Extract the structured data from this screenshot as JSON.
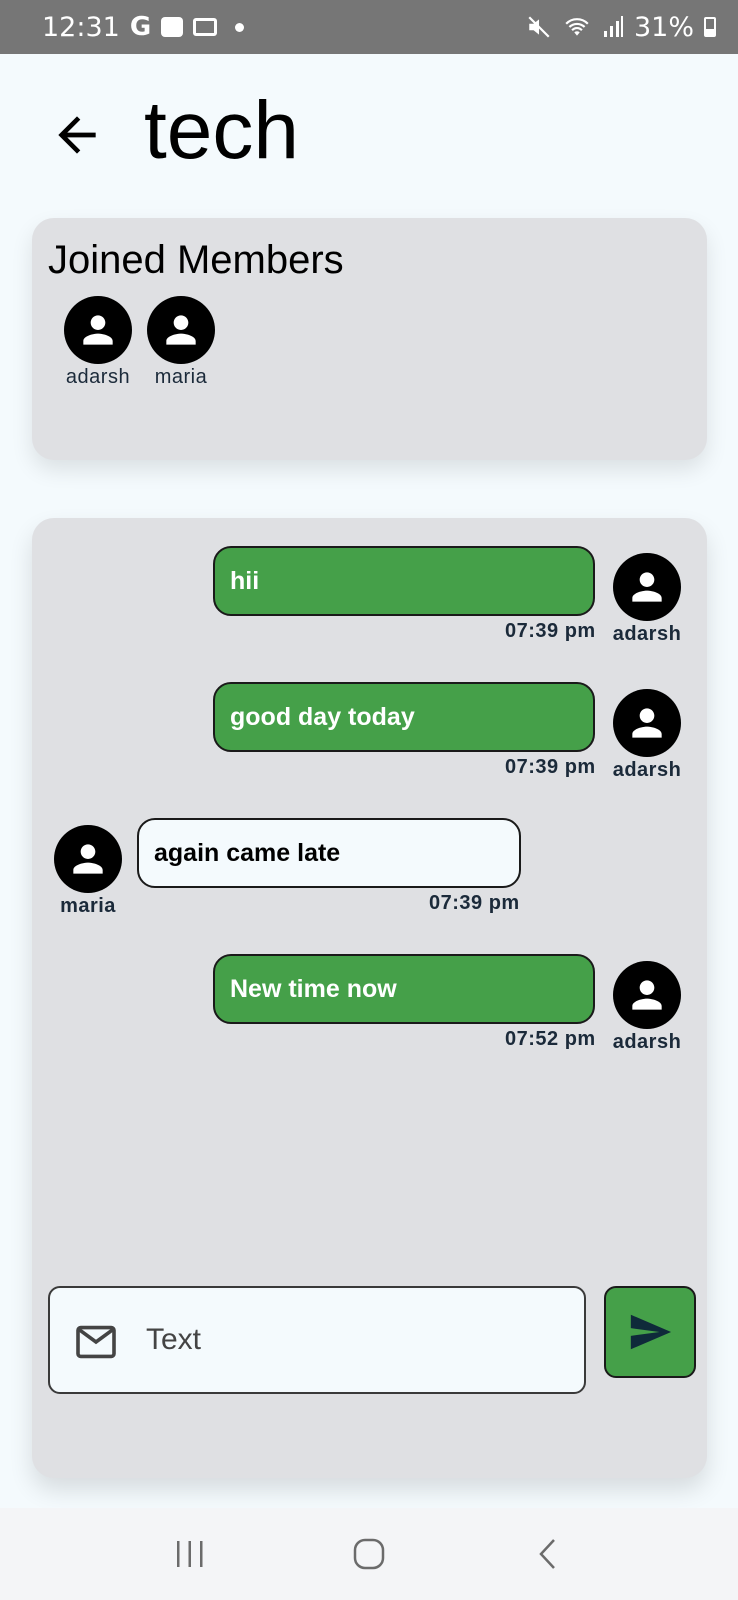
{
  "status_bar": {
    "time": "12:31",
    "carrier_glyph": "G",
    "battery": "31%",
    "icons": [
      "google-icon",
      "shopping-bag-icon",
      "calendar-icon",
      "dot-icon",
      "mute-icon",
      "wifi-icon",
      "signal-icon",
      "battery-icon"
    ]
  },
  "header": {
    "title": "tech",
    "back_icon": "arrow-left-icon"
  },
  "members": {
    "title": "Joined Members",
    "list": [
      {
        "name": "adarsh"
      },
      {
        "name": "maria"
      }
    ]
  },
  "messages": [
    {
      "text": "hii",
      "time": "07:39 pm",
      "author": "adarsh",
      "mine": true
    },
    {
      "text": "good day today",
      "time": "07:39 pm",
      "author": "adarsh",
      "mine": true
    },
    {
      "text": "again came late",
      "time": "07:39 pm",
      "author": "maria",
      "mine": false
    },
    {
      "text": "New time now",
      "time": "07:52 pm",
      "author": "adarsh",
      "mine": true
    }
  ],
  "composer": {
    "placeholder": "Text",
    "value": "",
    "input_icon": "mail-icon",
    "send_icon": "send-icon"
  },
  "nav_bar": {
    "icons": [
      "recents-icon",
      "home-icon",
      "back-icon"
    ]
  },
  "colors": {
    "accent": "#45a049",
    "card_bg": "#dfe0e3",
    "page_bg": "#f4fafd",
    "status_bar": "#767676"
  }
}
